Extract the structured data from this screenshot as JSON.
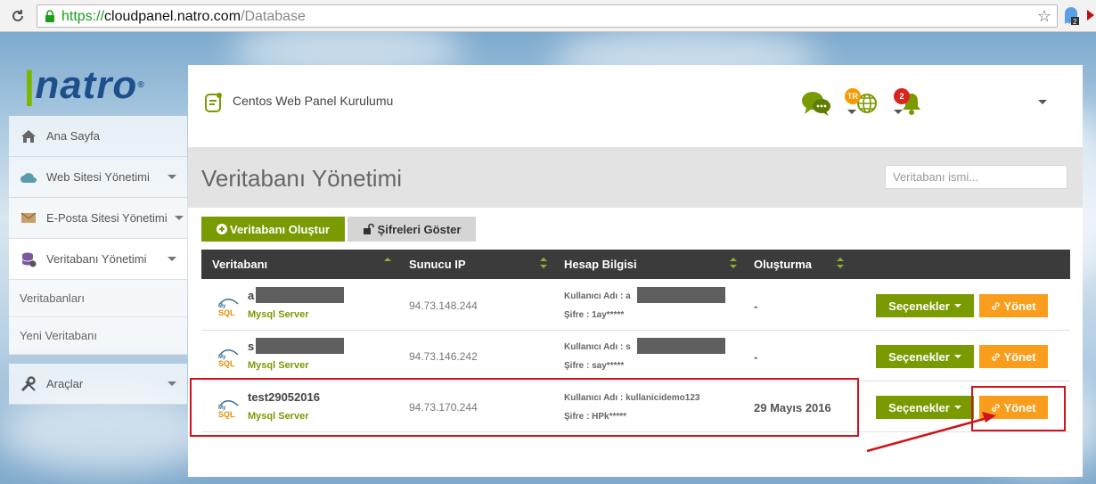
{
  "browser": {
    "url_scheme": "https://",
    "url_host": "cloudpanel.natro.com",
    "url_path": "/Database",
    "extension_badge": "2"
  },
  "logo": {
    "text_main": "natro",
    "reg": "®"
  },
  "sidebar": {
    "items": [
      {
        "label": "Ana Sayfa",
        "icon": "home-icon"
      },
      {
        "label": "Web Sitesi Yönetimi",
        "icon": "cloud-icon"
      },
      {
        "label": "E-Posta Sitesi Yönetimi",
        "icon": "envelope-icon"
      },
      {
        "label": "Veritabanı Yönetimi",
        "icon": "database-icon"
      },
      {
        "label": "Araçlar",
        "icon": "tools-icon"
      }
    ],
    "sub_items": [
      "Veritabanları",
      "Yeni Veritabanı"
    ]
  },
  "topbar": {
    "title": "Centos Web Panel Kurulumu",
    "lang_badge": "TR",
    "notif_count": "2"
  },
  "page": {
    "title": "Veritabanı Yönetimi",
    "search_placeholder": "Veritabanı ismi...",
    "create_button": "Veritabanı Oluştur",
    "show_pass_button": "Şifreleri Göster"
  },
  "table": {
    "columns": [
      "Veritabanı",
      "Sunucu IP",
      "Hesap Bilgisi",
      "Oluşturma"
    ],
    "rows": [
      {
        "name": "a",
        "type": "Mysql Server",
        "ip": "94.73.148.244",
        "user": "Kullanıcı Adı : a",
        "pass": "Şifre : 1ay*****",
        "created": "-"
      },
      {
        "name": "s",
        "type": "Mysql Server",
        "ip": "94.73.146.242",
        "user": "Kullanıcı Adı : s",
        "pass": "Şifre : say*****",
        "created": "-"
      },
      {
        "name": "test29052016",
        "type": "Mysql Server",
        "ip": "94.73.170.244",
        "user": "Kullanıcı Adı : kullanicidemo123",
        "pass": "Şifre : HPk*****",
        "created": "29 Mayıs 2016"
      }
    ],
    "options_label": "Seçenekler",
    "manage_label": "Yönet"
  },
  "colors": {
    "green": "#7a9a01",
    "orange": "#f99d1c",
    "header": "#3b3b3b",
    "annotation": "#d0131a"
  }
}
